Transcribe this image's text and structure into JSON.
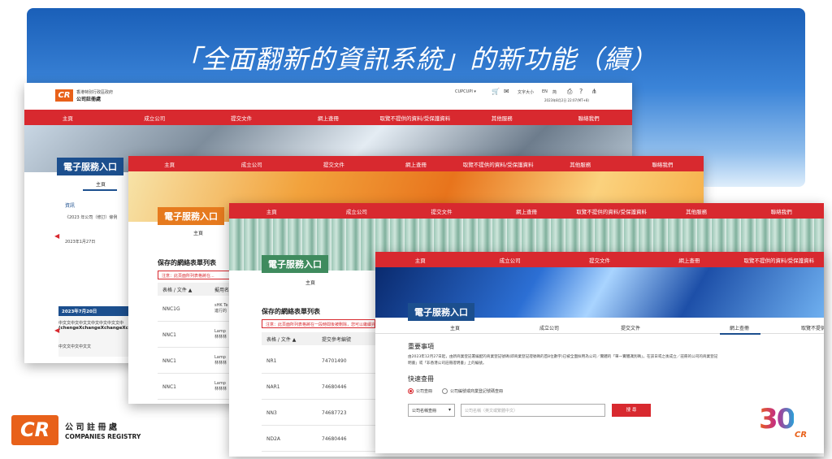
{
  "slide": {
    "title": "「全面翻新的資訊系統」的新功能（續）"
  },
  "ss1": {
    "agency_line1": "香港特別行政區政府",
    "agency_line2": "公司註冊處",
    "user_label": "CUPCUPI ▾",
    "font_size_label": "文字大小",
    "lang_en": "EN",
    "lang_sc": "简",
    "date_label": "2023年8月2日 22:07(MT+8)",
    "nav": [
      "主頁",
      "成立公司",
      "提交文件",
      "網上查冊",
      "取覽不提供的資料/受保護資料",
      "其他服務",
      "聯絡我們"
    ],
    "eservice": "電子服務入口",
    "tab": "主頁",
    "news_title": "資訊",
    "news_line": "《2023 年公司（修訂）條例",
    "news_date": "2023年1月27日",
    "card_date": "2023年7月20日",
    "card_text1": "中文文中文中文文中文中文中文文中",
    "card_text2": "(chengeXchangeXchangeXchange",
    "card_text3": "中文文中文中文文"
  },
  "ss2": {
    "nav": [
      "主頁",
      "成立公司",
      "提交文件",
      "網上查冊",
      "取覽不提供的資料/受保護資料",
      "其他服務",
      "聯絡我們"
    ],
    "eservice": "電子服務入口",
    "tab": "主頁",
    "list_title": "保存的網絡表單列表",
    "warning": "注意：此頁面所列表格將在...",
    "col1": "表格 / 文件 ▲",
    "col2": "擬用名",
    "rows": [
      {
        "c1": "NNC1G",
        "c2": "sHK Te 進行的"
      },
      {
        "c1": "NNC1",
        "c2": "Lamp 林林林"
      },
      {
        "c1": "NNC1",
        "c2": "Lamp 林林林"
      },
      {
        "c1": "NNC1",
        "c2": "Lamp 林林林"
      }
    ]
  },
  "ss3": {
    "nav": [
      "主頁",
      "成立公司",
      "提交文件",
      "網上查冊",
      "取覽不提供的資料/受保護資料",
      "其他服務",
      "聯絡我們"
    ],
    "eservice": "電子服務入口",
    "tab": "主頁",
    "list_title": "保存的網絡表單列表",
    "warning": "注意：此頁面所列表格將在一段時間後被刪除，您可以繼續完成",
    "col1": "表格 / 文件 ▲",
    "col2": "提交參考編號",
    "rows": [
      {
        "c1": "NR1",
        "c2": "74701490"
      },
      {
        "c1": "NAR1",
        "c2": "74680446"
      },
      {
        "c1": "NN3",
        "c2": "74687723"
      },
      {
        "c1": "ND2A",
        "c2": "74680446"
      }
    ]
  },
  "ss4": {
    "nav": [
      "主頁",
      "成立公司",
      "提交文件",
      "網上查冊",
      "取覽不提供的資料/受保護資料"
    ],
    "eservice": "電子服務入口",
    "tabs": [
      "主頁",
      "成立公司",
      "提交文件",
      "網上查冊",
      "取覽不提供"
    ],
    "notice_title": "重要事項",
    "notice_text": "由2023年12月27日起，由新商業登記署編配的商業登記號碼(即商業登記證號碼的首8位數字)已被全面採用為公司／實體的「單一實體識別碼」。在該日或之後成立／註冊的公司的商業登記",
    "notice_text2": "明書」或「非香港公司註冊證明書」上的編號。",
    "quick_title": "快速查冊",
    "radio1": "公司查冊",
    "radio2": "公司編號或商業登記號碼查冊",
    "select_label": "公司名稱查冊",
    "input_placeholder": "公司名稱（英文或繁體中文）",
    "search_btn": "搜 尋"
  },
  "logo": {
    "cn": "公 司 註 冊 處",
    "en": "COMPANIES REGISTRY",
    "mark": "CR"
  },
  "anniv": {
    "num": "30",
    "mark": "CR"
  }
}
